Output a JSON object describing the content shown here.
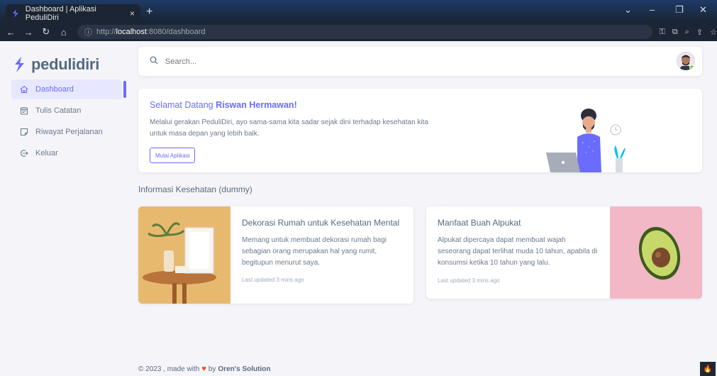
{
  "browser": {
    "tab_title": "Dashboard | Aplikasi PeduliDiri",
    "tab_close": "×",
    "new_tab": "+",
    "url_info": "ⓘ",
    "url_prefix": "http://",
    "url_host": "localhost",
    "url_rest": ":8080/dashboard"
  },
  "app": {
    "brand": "pedulidiri",
    "brand_color": "#696cff"
  },
  "sidebar": {
    "items": [
      {
        "label": "Dashboard",
        "icon": "home-icon"
      },
      {
        "label": "Tulis Catatan",
        "icon": "calendar-icon"
      },
      {
        "label": "Riwayat Perjalanan",
        "icon": "note-icon"
      },
      {
        "label": "Keluar",
        "icon": "logout-icon"
      }
    ]
  },
  "search": {
    "placeholder": "Search..."
  },
  "welcome": {
    "greeting": "Selamat Datang ",
    "name": "Riswan Hermawan!",
    "text": "Melalui gerakan PeduliDiri, ayo sama-sama kita sadar sejak dini terhadap kesehatan kita untuk masa depan yang lebih baik.",
    "button": "Mulai Aplikasi"
  },
  "section_title": "Informasi Kesehatan (dummy)",
  "cards": [
    {
      "title": "Dekorasi Rumah untuk Kesehatan Mental",
      "text": "Memang untuk membuat dekorasi rumah bagi sebagian orang merupakan hal yang rumit, begitupun menurut saya.",
      "updated": "Last updated 3 mins ago"
    },
    {
      "title": "Manfaat Buah Alpukat",
      "text": "Alpukat dipercaya dapat membuat wajah seseorang dapat terlihat muda 10 tahun, apabila di konsumsi ketika 10 tahun yang lalu.",
      "updated": "Last updated 3 mins ago"
    }
  ],
  "footer": {
    "prefix": "© 2023 , made with",
    "by": "by",
    "company": "Oren's Solution"
  }
}
